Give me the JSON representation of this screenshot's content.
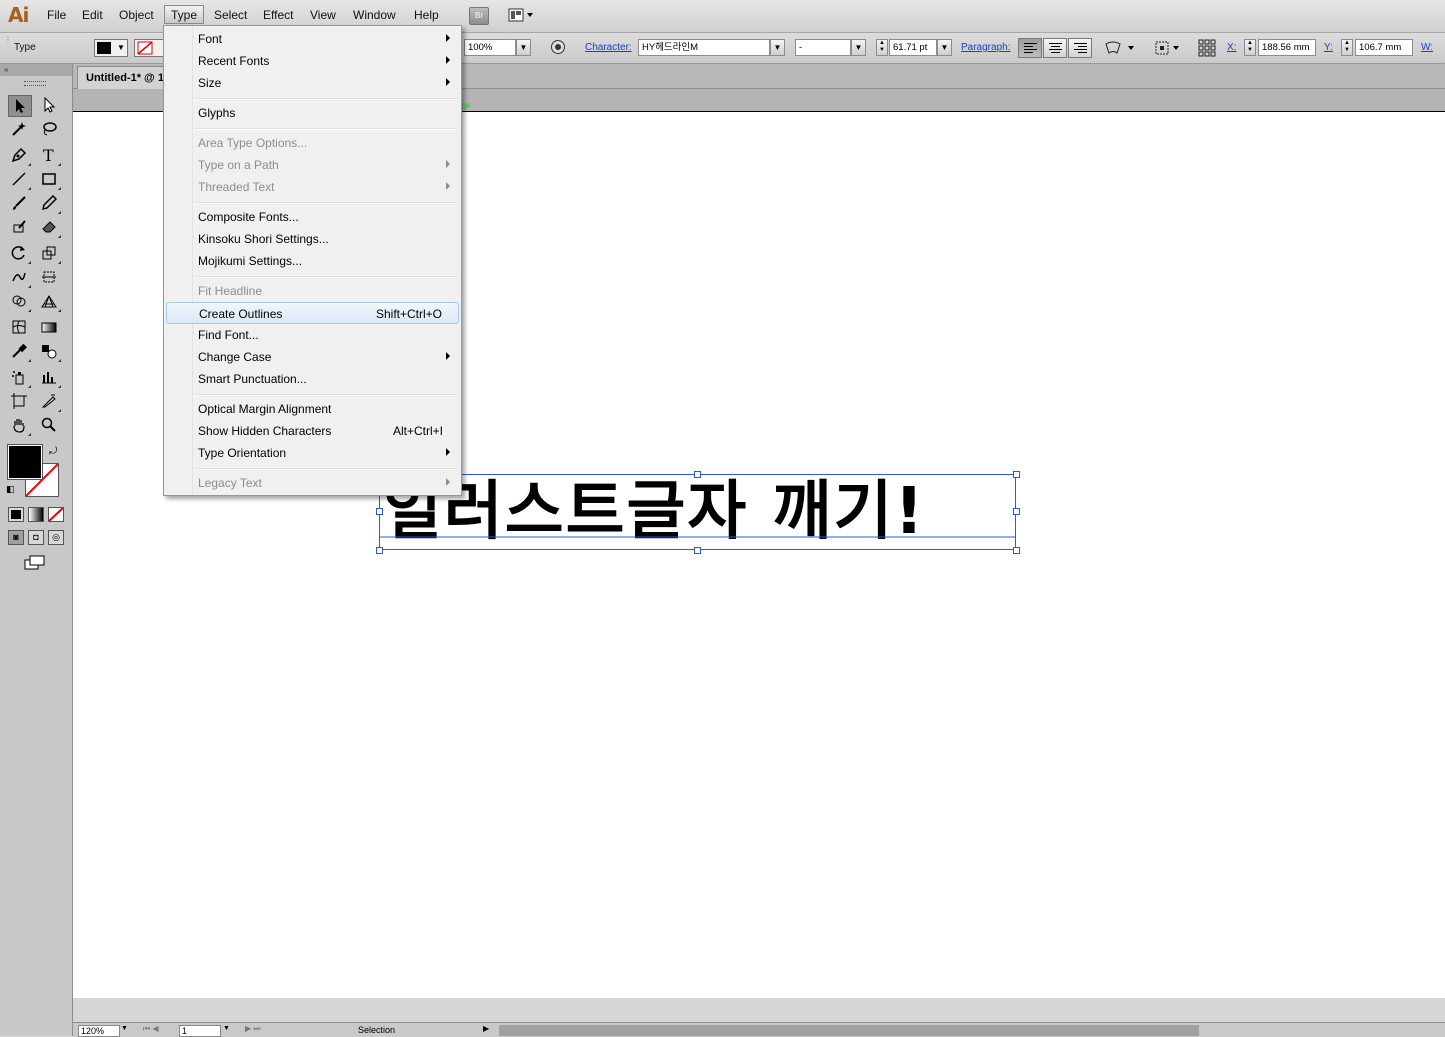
{
  "app": {
    "logo": "Ai"
  },
  "menubar": {
    "items": [
      "File",
      "Edit",
      "Object",
      "Type",
      "Select",
      "Effect",
      "View",
      "Window",
      "Help"
    ],
    "bridge_label": "Br"
  },
  "control_bar": {
    "mode_label": "Type",
    "opacity_value": "100%",
    "character_link": "Character:",
    "font_family": "HY헤드라인M",
    "font_style": "-",
    "font_size": "61.71 pt",
    "paragraph_link": "Paragraph:",
    "x_label": "X:",
    "x_value": "188.56 mm",
    "y_label": "Y:",
    "y_value": "106.7 mm",
    "w_label": "W:"
  },
  "document": {
    "tab_title": "Untitled-1* @ 1",
    "page_label": "age",
    "text_content": "일러스트글자 깨기!"
  },
  "status_bar": {
    "zoom": "120%",
    "page": "1",
    "status_text": "Selection"
  },
  "type_menu": {
    "items": [
      {
        "label": "Font",
        "shortcut": "",
        "submenu": true,
        "enabled": true
      },
      {
        "label": "Recent Fonts",
        "shortcut": "",
        "submenu": true,
        "enabled": true
      },
      {
        "label": "Size",
        "shortcut": "",
        "submenu": true,
        "enabled": true
      },
      {
        "label": "Glyphs",
        "shortcut": "",
        "submenu": false,
        "enabled": true
      },
      {
        "label": "Area Type Options...",
        "shortcut": "",
        "submenu": false,
        "enabled": false
      },
      {
        "label": "Type on a Path",
        "shortcut": "",
        "submenu": true,
        "enabled": false
      },
      {
        "label": "Threaded Text",
        "shortcut": "",
        "submenu": true,
        "enabled": false
      },
      {
        "label": "Composite Fonts...",
        "shortcut": "",
        "submenu": false,
        "enabled": true
      },
      {
        "label": "Kinsoku Shori Settings...",
        "shortcut": "",
        "submenu": false,
        "enabled": true
      },
      {
        "label": "Mojikumi Settings...",
        "shortcut": "",
        "submenu": false,
        "enabled": true
      },
      {
        "label": "Fit Headline",
        "shortcut": "",
        "submenu": false,
        "enabled": false
      },
      {
        "label": "Create Outlines",
        "shortcut": "Shift+Ctrl+O",
        "submenu": false,
        "enabled": true,
        "highlighted": true
      },
      {
        "label": "Find Font...",
        "shortcut": "",
        "submenu": false,
        "enabled": true
      },
      {
        "label": "Change Case",
        "shortcut": "",
        "submenu": true,
        "enabled": true
      },
      {
        "label": "Smart Punctuation...",
        "shortcut": "",
        "submenu": false,
        "enabled": true
      },
      {
        "label": "Optical Margin Alignment",
        "shortcut": "",
        "submenu": false,
        "enabled": true
      },
      {
        "label": "Show Hidden Characters",
        "shortcut": "Alt+Ctrl+I",
        "submenu": false,
        "enabled": true
      },
      {
        "label": "Type Orientation",
        "shortcut": "",
        "submenu": true,
        "enabled": true
      },
      {
        "label": "Legacy Text",
        "shortcut": "",
        "submenu": true,
        "enabled": false
      }
    ]
  },
  "colors": {
    "logo": "#a85f1e",
    "link": "#1a3fcc",
    "selection": "#2a5ad8",
    "menu_highlight_border": "#a8c7ea"
  }
}
